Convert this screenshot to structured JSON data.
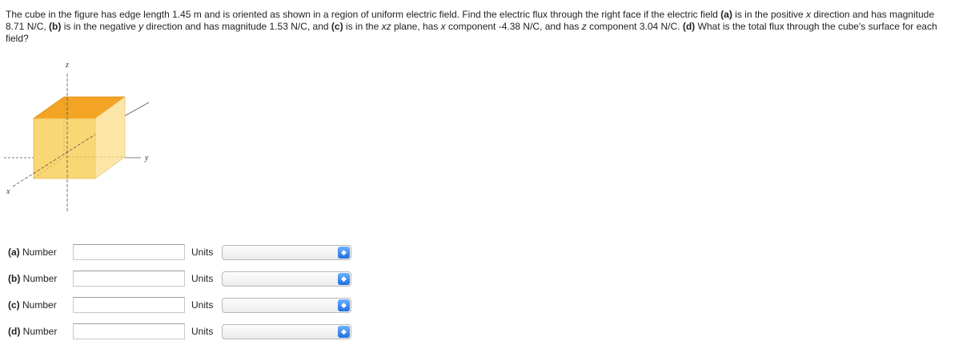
{
  "problem": {
    "p1": "The cube in the figure has edge length 1.45 m and is oriented as shown in a region of uniform electric field. Find the electric flux through the right face if the electric field ",
    "a_tag": "(a)",
    "p2": " is in the positive ",
    "x1": "x",
    "p3": " direction and has magnitude 8.71 N/C, ",
    "b_tag": "(b)",
    "p4": " is in the negative ",
    "y1": "y",
    "p5": " direction and has magnitude 1.53 N/C, and ",
    "c_tag": "(c)",
    "p6": " is in the ",
    "xz": "xz",
    "p7": " plane, has ",
    "x2": "x",
    "p8": " component -4.38 N/C, and has ",
    "z1": "z",
    "p9": " component 3.04 N/C. ",
    "d_tag": "(d)",
    "p10": " What is the total flux through the cube's surface for each field?"
  },
  "figure": {
    "axis_z": "z",
    "axis_y": "y",
    "axis_x": "x",
    "colors": {
      "top": "#f3a424",
      "front": "#f9d774",
      "side": "#fbe6a8"
    }
  },
  "answers": [
    {
      "tag": "(a)",
      "label": "Number",
      "value": "",
      "units_label": "Units",
      "units_value": ""
    },
    {
      "tag": "(b)",
      "label": "Number",
      "value": "",
      "units_label": "Units",
      "units_value": ""
    },
    {
      "tag": "(c)",
      "label": "Number",
      "value": "",
      "units_label": "Units",
      "units_value": ""
    },
    {
      "tag": "(d)",
      "label": "Number",
      "value": "",
      "units_label": "Units",
      "units_value": ""
    }
  ],
  "select_arrow_icon": "up-down-chevron-icon"
}
